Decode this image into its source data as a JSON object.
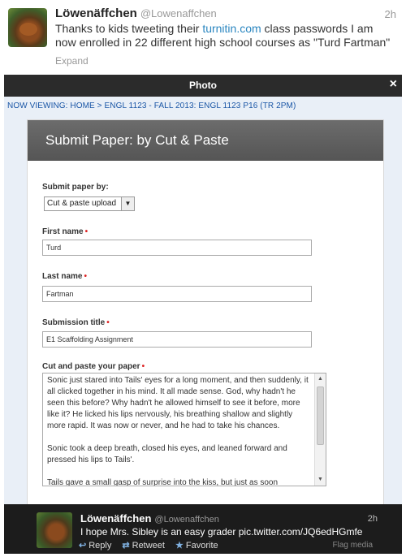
{
  "tweet": {
    "name": "Löwenäffchen",
    "handle": "@Lowenaffchen",
    "time": "2h",
    "text_before_link": "Thanks to kids tweeting their ",
    "link": "turnitin.com",
    "text_after_link": " class passwords I am now enrolled in 22 different high school courses as \"Turd Fartman\"",
    "expand": "Expand"
  },
  "photo_bar": {
    "title": "Photo",
    "close": "×"
  },
  "breadcrumb": "NOW VIEWING: HOME > ENGL 1123 - FALL 2013: ENGL 1123 P16 (TR 2PM)",
  "panel": {
    "title": "Submit Paper: by Cut & Paste",
    "submit_by_label": "Submit paper by:",
    "submit_by_value": "Cut & paste upload",
    "first_name_label": "First name",
    "first_name_value": "Turd",
    "last_name_label": "Last name",
    "last_name_value": "Fartman",
    "submission_title_label": "Submission title",
    "submission_title_value": "E1 Scaffolding Assignment",
    "paper_label": "Cut and paste your paper",
    "paper_text": "Sonic just stared into Tails' eyes for a long moment, and then suddenly, it all clicked together in his mind. It all made sense. God, why hadn't he seen this before? Why hadn't he allowed himself to see it before, more like it? He licked his lips nervously, his breathing shallow and slightly more rapid. It was now or never, and he had to take his chances.\n\nSonic took a deep breath, closed his eyes, and leaned forward and pressed his lips to Tails'.\n\nTails gave a small gasp of surprise into the kiss, but just as soon"
  },
  "footer": {
    "name": "Löwenäffchen",
    "handle": "@Lowenaffchen",
    "time": "2h",
    "text": "I hope Mrs. Sibley is an easy grader pic.twitter.com/JQ6edHGmfe",
    "reply": "Reply",
    "retweet": "Retweet",
    "favorite": "Favorite",
    "flag": "Flag media"
  },
  "colors": {
    "link": "#2a86c0",
    "required_dot": "#dd2222",
    "panel_header": "#5e5e5e"
  }
}
